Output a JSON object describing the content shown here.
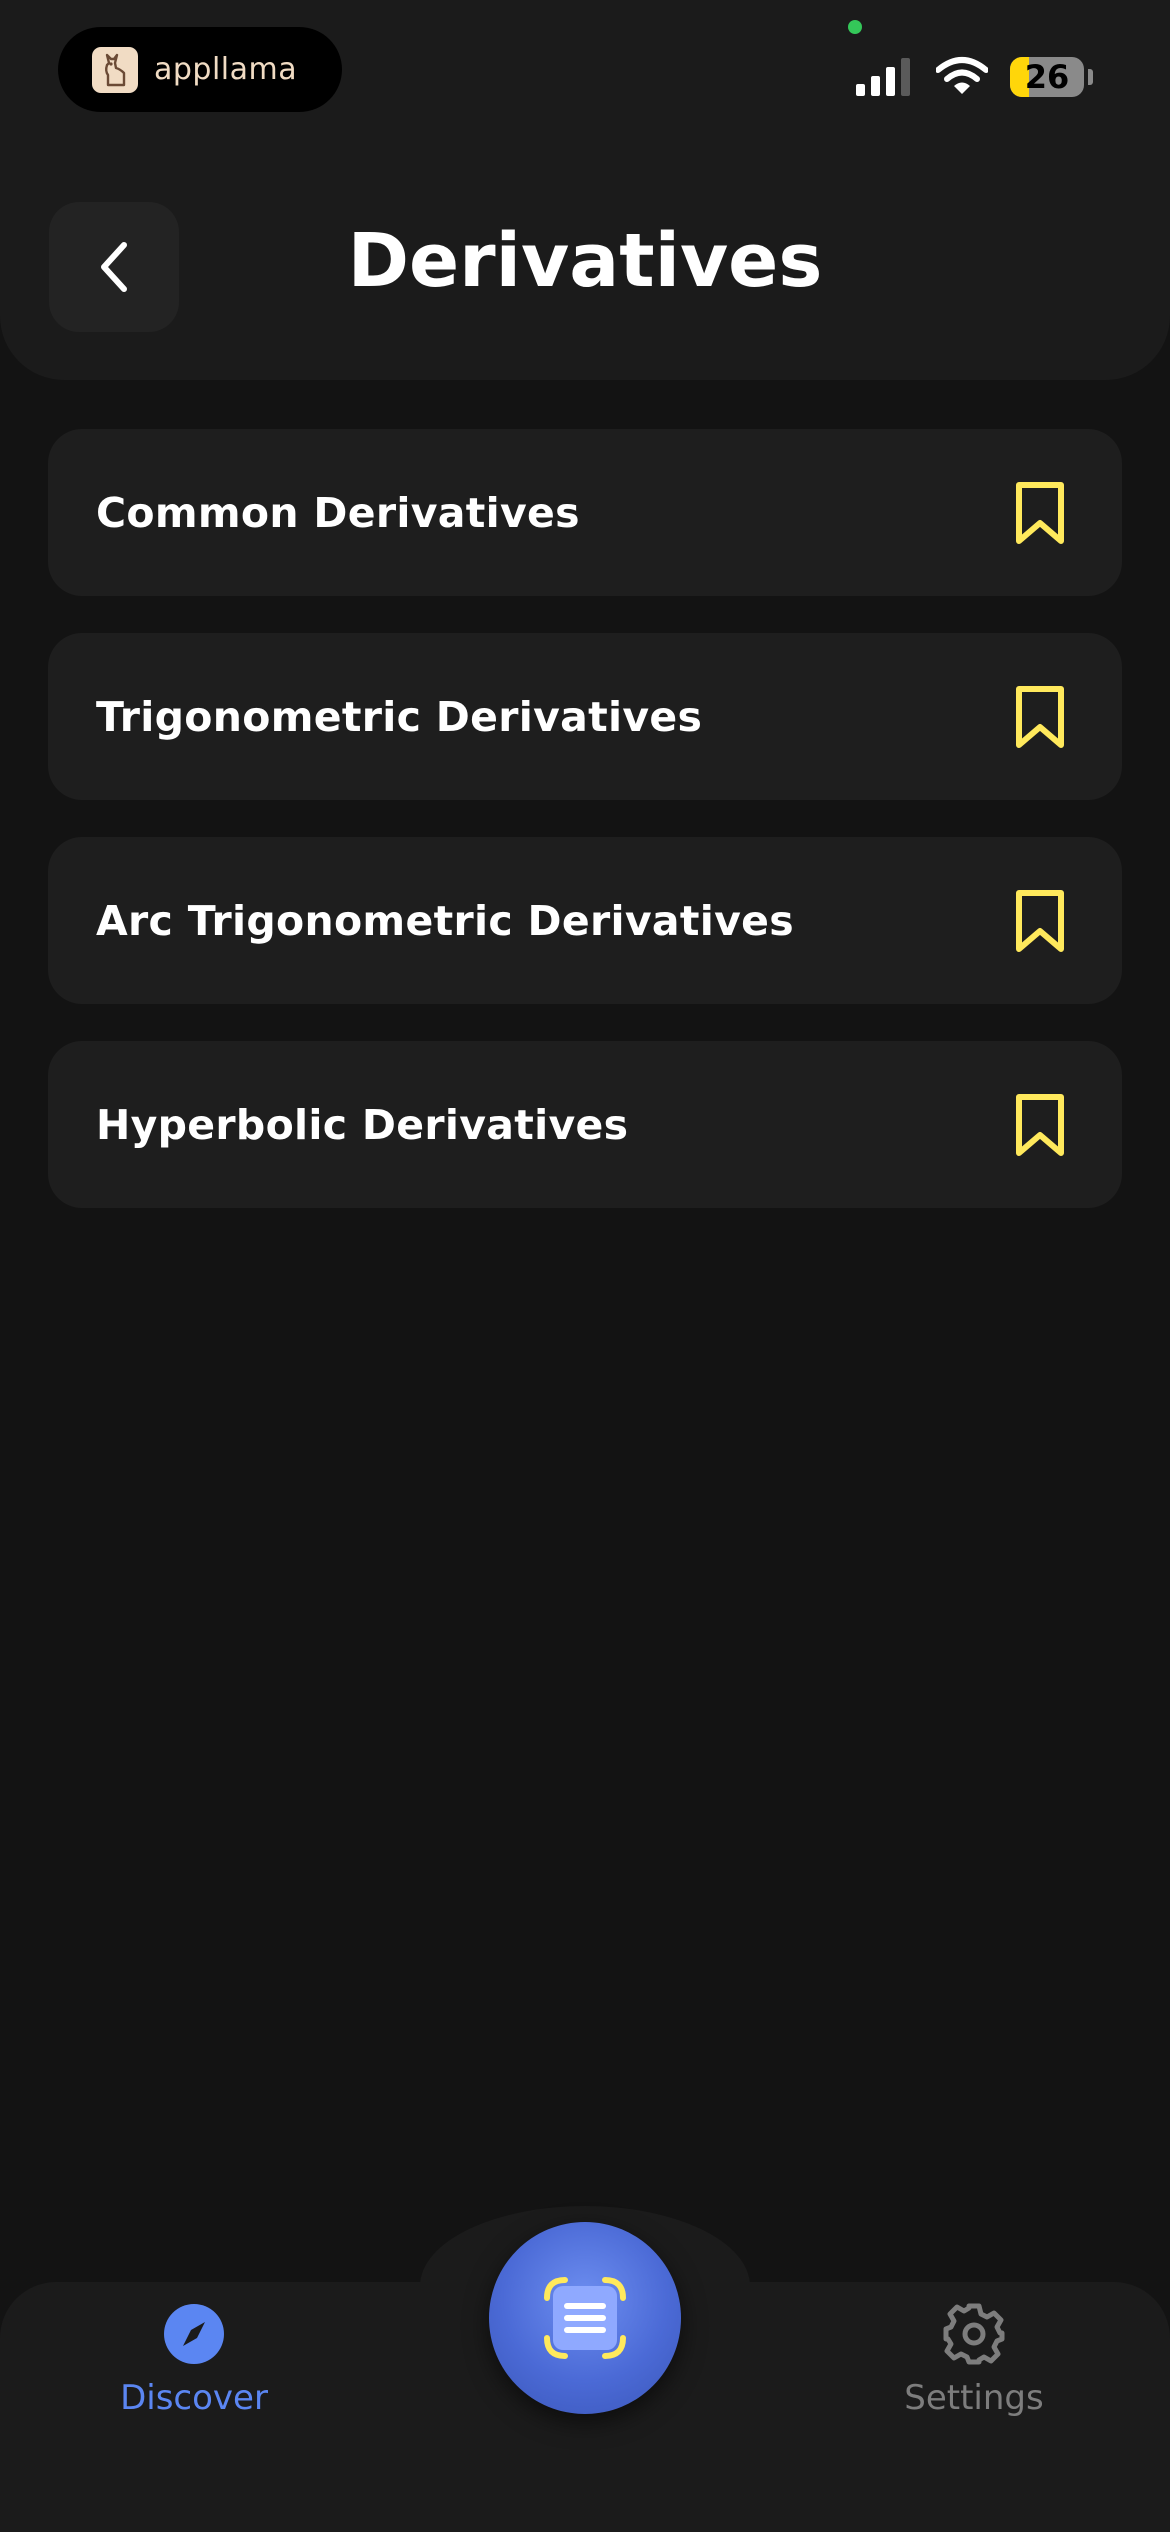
{
  "status_bar": {
    "app_name": "appllama",
    "battery_level": "26",
    "battery_fraction": 0.26
  },
  "header": {
    "title": "Derivatives"
  },
  "list": {
    "items": [
      {
        "label": "Common Derivatives"
      },
      {
        "label": "Trigonometric Derivatives"
      },
      {
        "label": "Arc Trigonometric Derivatives"
      },
      {
        "label": "Hyperbolic Derivatives"
      }
    ]
  },
  "bottom_nav": {
    "discover_label": "Discover",
    "settings_label": "Settings"
  },
  "colors": {
    "accent": "#5b86f2",
    "bookmark": "#ffe95c",
    "background": "#131313",
    "card": "#1e1e1e"
  },
  "icons": {
    "back": "chevron-left-icon",
    "bookmark": "bookmark-icon",
    "discover": "compass-icon",
    "scan": "scan-document-icon",
    "settings": "gear-icon"
  }
}
